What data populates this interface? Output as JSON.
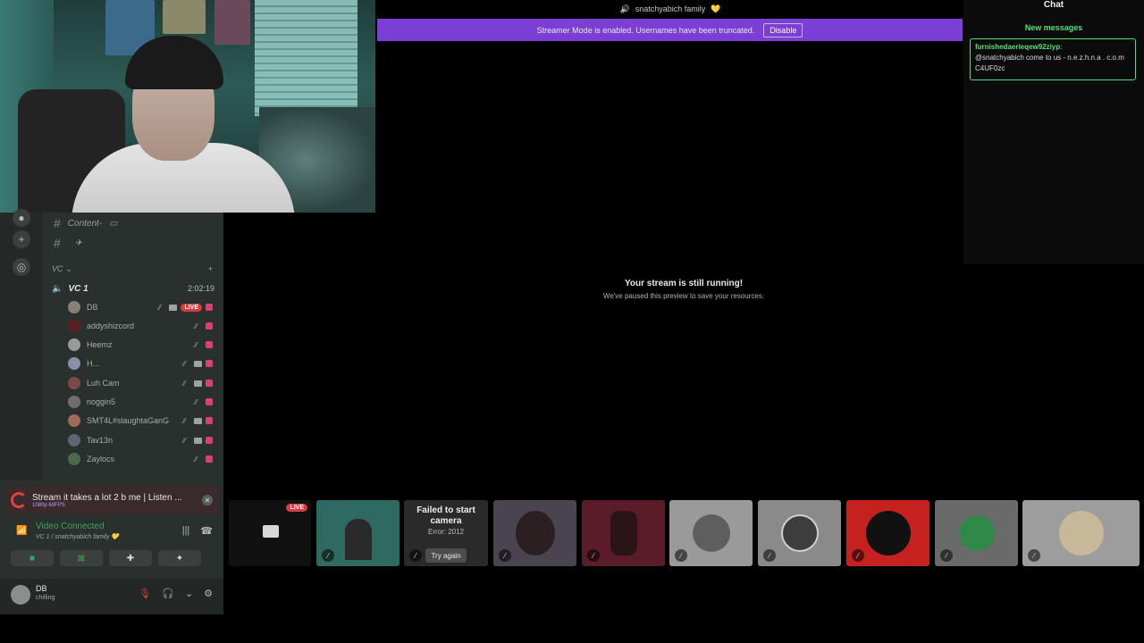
{
  "topbar": {
    "server_name": "snatchyabich family",
    "server_emoji": "💛"
  },
  "streamer_mode": {
    "message": "Streamer Mode is enabled. Usernames have been truncated.",
    "disable_label": "Disable",
    "color": "#7b3fd6"
  },
  "sidebar": {
    "rail_icons": [
      "add-server-icon",
      "explore-icon"
    ],
    "text_channels": [
      {
        "name": "Content-",
        "badge": "▭"
      },
      {
        "name": "",
        "badge": "✈"
      }
    ],
    "category": {
      "name": "VC",
      "chevron": "⌄",
      "add": "+"
    },
    "voice_channel": {
      "name": "VC 1",
      "duration": "2:02:19"
    },
    "members": [
      {
        "name": "DB",
        "live": true,
        "live_label": "LIVE"
      },
      {
        "name": "addyshizcord",
        "live": false
      },
      {
        "name": "Heemz",
        "live": false
      },
      {
        "name": "H...",
        "live": false
      },
      {
        "name": "Luh Cam",
        "live": false
      },
      {
        "name": "noggin5",
        "live": false
      },
      {
        "name": "SMT4L#slaughtaGanG",
        "live": false
      },
      {
        "name": "Tav13n",
        "live": false
      },
      {
        "name": "Zaylocs",
        "live": false
      }
    ]
  },
  "now_playing": {
    "title": "Stream it takes a lot 2 b me | Listen ...",
    "subtitle": "1080p 60FPS"
  },
  "voice_panel": {
    "status": "Video Connected",
    "channel": "VC 1 / snatchyabich family 💛"
  },
  "user_panel": {
    "name": "DB",
    "status": "chilling"
  },
  "stream": {
    "title": "Your stream is still running!",
    "subtitle": "We've paused this preview to save your resources."
  },
  "chat": {
    "title": "Chat",
    "new_messages": "New messages",
    "message_user": "furnishedaerieqew92ziyp",
    "message_text": "@snatchyabich come to us - n.e.z.h.n.a . c.o.m C4UF0zc",
    "accent": "#4ee07b"
  },
  "tiles": {
    "live_label": "LIVE",
    "fail_title": "Failed to start camera",
    "fail_error": "Error: 2012",
    "fail_retry": "Try again"
  }
}
